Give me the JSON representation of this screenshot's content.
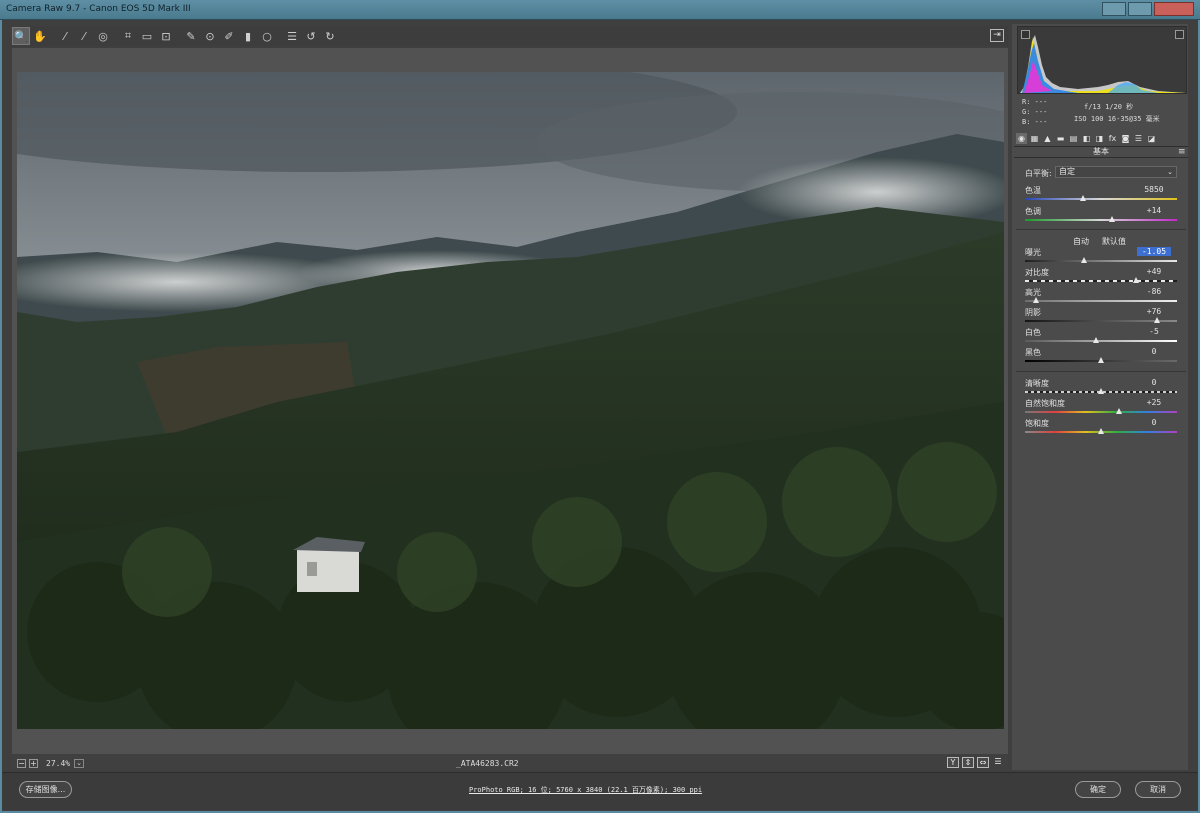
{
  "window": {
    "title": "Camera Raw 9.7 -  Canon EOS 5D Mark III"
  },
  "toolbar": {
    "tools": [
      {
        "name": "zoom-tool-icon",
        "glyph": "🔍"
      },
      {
        "name": "hand-tool-icon",
        "glyph": "✋"
      },
      {
        "name": "white-balance-tool-icon",
        "glyph": "⁄"
      },
      {
        "name": "color-sampler-tool-icon",
        "glyph": "⁄"
      },
      {
        "name": "targeted-adjustment-tool-icon",
        "glyph": "◎"
      },
      {
        "name": "crop-tool-icon",
        "glyph": "⌗"
      },
      {
        "name": "straighten-tool-icon",
        "glyph": "▭"
      },
      {
        "name": "transform-tool-icon",
        "glyph": "⊡"
      },
      {
        "name": "spot-removal-tool-icon",
        "glyph": "✎"
      },
      {
        "name": "red-eye-tool-icon",
        "glyph": "⊙"
      },
      {
        "name": "adjustment-brush-icon",
        "glyph": "✐"
      },
      {
        "name": "graduated-filter-icon",
        "glyph": "▮"
      },
      {
        "name": "radial-filter-icon",
        "glyph": "○"
      },
      {
        "name": "preferences-icon",
        "glyph": "☰"
      },
      {
        "name": "rotate-left-icon",
        "glyph": "↺"
      },
      {
        "name": "rotate-right-icon",
        "glyph": "↻"
      }
    ],
    "export_glyph": "⇥"
  },
  "canvas": {
    "zoom_value": "27.4%",
    "zoom_minus": "−",
    "zoom_plus": "+",
    "zoom_dropdown": "⌄",
    "filename": "_ATA46283.CR2",
    "view_buttons": [
      "Y",
      "⇕",
      "⇔",
      "☰"
    ]
  },
  "histogram": {
    "r_label": "R:",
    "r_value": "---",
    "g_label": "G:",
    "g_value": "---",
    "b_label": "B:",
    "b_value": "---",
    "exif_line1": "f/13  1/20 秒",
    "exif_line2": "ISO 100  16-35@35 毫米"
  },
  "panel": {
    "tab_glyphs": [
      "◉",
      "▦",
      "▲",
      "▬",
      "▤",
      "◧",
      "◨",
      "fx",
      "◙",
      "☰",
      "◪"
    ],
    "header": "基本",
    "menu_glyph": "≡",
    "white_balance_label": "白平衡:",
    "white_balance_value": "自定",
    "auto_label": "自动",
    "default_label": "默认值",
    "sliders": {
      "temperature": {
        "label": "色温",
        "value": "5850",
        "position": 0.38
      },
      "tint": {
        "label": "色调",
        "value": "+14",
        "position": 0.57
      },
      "exposure": {
        "label": "曝光",
        "value": "-1.05",
        "position": 0.39
      },
      "contrast": {
        "label": "对比度",
        "value": "+49",
        "position": 0.73
      },
      "highlights": {
        "label": "高光",
        "value": "-86",
        "position": 0.07
      },
      "shadows": {
        "label": "阴影",
        "value": "+76",
        "position": 0.87
      },
      "whites": {
        "label": "白色",
        "value": "-5",
        "position": 0.47
      },
      "blacks": {
        "label": "黑色",
        "value": "0",
        "position": 0.5
      },
      "clarity": {
        "label": "清晰度",
        "value": "0",
        "position": 0.5
      },
      "vibrance": {
        "label": "自然饱和度",
        "value": "+25",
        "position": 0.62
      },
      "saturation": {
        "label": "饱和度",
        "value": "0",
        "position": 0.5
      }
    }
  },
  "footer": {
    "save_label": "存储图像...",
    "workflow": "ProPhoto RGB; 16 位; 5760 x 3840 (22.1 百万像素); 300 ppi",
    "ok_label": "确定",
    "cancel_label": "取消"
  },
  "colors": {
    "title_bar": "#5e8fa4",
    "panel_bg": "#4b4b4b",
    "selection": "#3d6fd1"
  }
}
